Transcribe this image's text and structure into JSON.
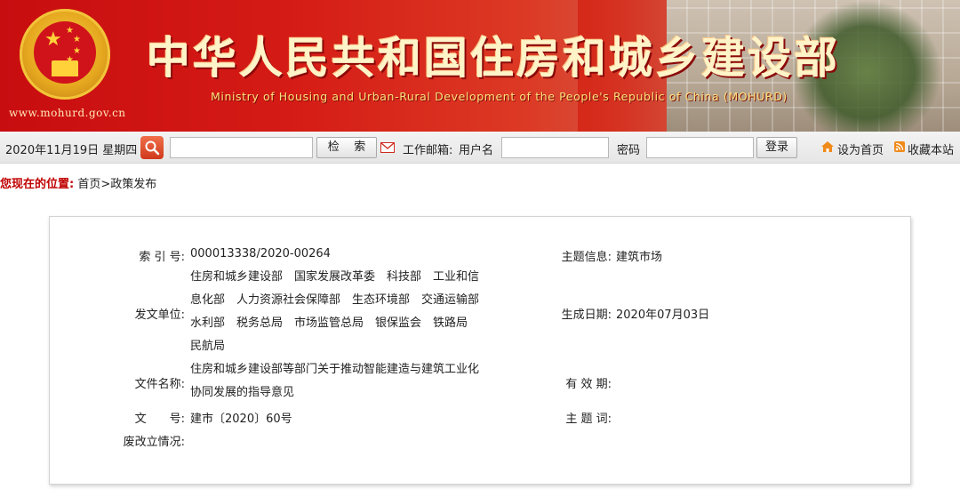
{
  "banner": {
    "site_url": "www.mohurd.gov.cn",
    "title": "中华人民共和国住房和城乡建设部",
    "subtitle": "Ministry of Housing and Urban-Rural Development of the People's Republic of China (MOHURD)"
  },
  "toolbar": {
    "date": "2020年11月19日 星期四",
    "search_placeholder": "",
    "search_button": "检    索",
    "mail_label": "工作邮箱:",
    "username_label": "用户名",
    "password_label": "密码",
    "login_button": "登录",
    "set_home_link": "设为首页",
    "bookmark_link": "收藏本站"
  },
  "breadcrumb": {
    "label": "您现在的位置:",
    "path": "首页>政策发布"
  },
  "doc_info": {
    "index_no_label": "索 引 号:",
    "index_no": "000013338/2020-00264",
    "topic_label": "主题信息:",
    "topic": "建筑市场",
    "issuer_label": "发文单位:",
    "issuer": "住房和城乡建设部　国家发展改革委　科技部　工业和信息化部　人力资源社会保障部　生态环境部　交通运输部　水利部　税务总局　市场监管总局　银保监会　铁路局　民航局",
    "date_label": "生成日期:",
    "date": "2020年07月03日",
    "doc_name_label": "文件名称:",
    "doc_name": "住房和城乡建设部等部门关于推动智能建造与建筑工业化协同发展的指导意见",
    "validity_label": "有 效 期:",
    "validity": "",
    "doc_no_label": "文　　号:",
    "doc_no": "建市〔2020〕60号",
    "keywords_label": "主 题 词:",
    "keywords": "",
    "status_label": "废改立情况:",
    "status": ""
  },
  "colors": {
    "banner_red": "#c80d10",
    "breadcrumb_label": "#c00000",
    "title_gold": "#fff3c8"
  }
}
